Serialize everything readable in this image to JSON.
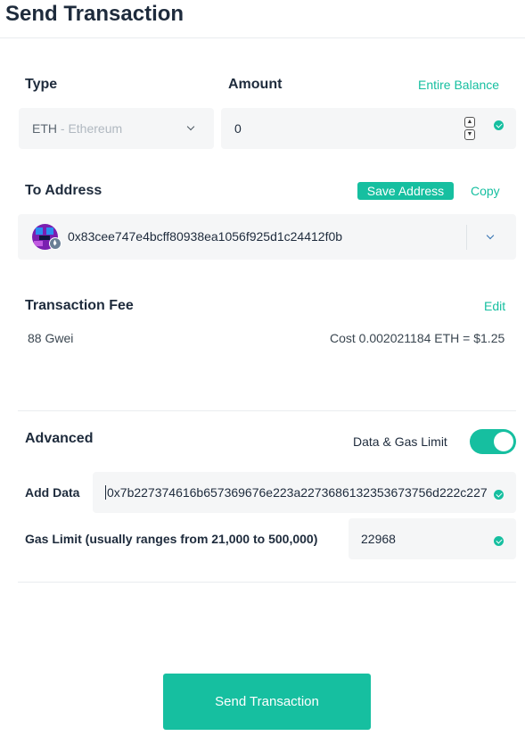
{
  "header": {
    "title": "Send Transaction"
  },
  "type": {
    "label": "Type",
    "selected_symbol": "ETH",
    "selected_name": " - Ethereum"
  },
  "amount": {
    "label": "Amount",
    "entire_balance_label": "Entire Balance",
    "value": "0"
  },
  "to_address": {
    "label": "To Address",
    "save_label": "Save Address",
    "copy_label": "Copy",
    "value": "0x83cee747e4bcff80938ea1056f925d1c24412f0b"
  },
  "fee": {
    "label": "Transaction Fee",
    "edit_label": "Edit",
    "gas_price": "88 Gwei",
    "cost": "Cost 0.002021184 ETH = $1.25"
  },
  "advanced": {
    "label": "Advanced",
    "toggle_label": "Data & Gas Limit",
    "toggle_on": true,
    "data_label": "Add Data",
    "data_value": "0x7b227374616b657369676e223a2273686132353673756d222c227",
    "gas_limit_label": "Gas Limit (usually ranges from 21,000 to 500,000)",
    "gas_limit_value": "22968"
  },
  "submit": {
    "label": "Send Transaction"
  },
  "colors": {
    "accent": "#16bfa0",
    "field_bg": "#f5f6f7",
    "text": "#1e2b3c"
  },
  "icons": [
    "chevron-down-icon",
    "check-icon",
    "eth-icon",
    "identicon"
  ]
}
